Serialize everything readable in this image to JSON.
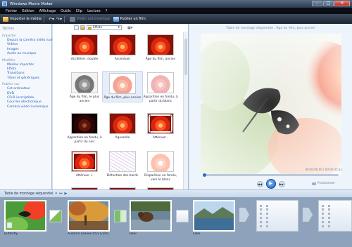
{
  "window": {
    "title": "Windows Movie Maker"
  },
  "menu": [
    "Fichier",
    "Edition",
    "Affichage",
    "Outils",
    "Clip",
    "Lecture",
    "?"
  ],
  "toolbar": {
    "import_label": "Importer le média",
    "auto_movie_label": "Vidéo automatique",
    "publish_label": "Publier un film"
  },
  "tasks": {
    "title": "Tâches",
    "sections": [
      {
        "label": "Importer",
        "links": [
          "Depuis la caméra vidéo numérique",
          "Vidéos",
          "Images",
          "Audio ou musique"
        ]
      },
      {
        "label": "Modifier",
        "links": [
          "Médias importés",
          "Effets",
          "Transitions",
          "Titres et génériques"
        ]
      },
      {
        "label": "Publier sur",
        "links": [
          "Cet ordinateur",
          "DVD",
          "CD-R inscriptible",
          "Courrier électronique",
          "Caméra vidéo numérique"
        ]
      }
    ]
  },
  "effects": {
    "dropdown_value": "Effets",
    "items": [
      {
        "label": "Accélérer, double",
        "style": "flower"
      },
      {
        "label": "Accentuer",
        "style": "flower"
      },
      {
        "label": "Âge du film, ancien",
        "style": "flower"
      },
      {
        "label": "Âge du film, le plus ancien",
        "style": "bw"
      },
      {
        "label": "Âge du film, plus ancien",
        "style": "faded",
        "selected": true
      },
      {
        "label": "Apparition en fondu, à partir du blanc",
        "style": "pinkfade"
      },
      {
        "label": "Apparition en fondu, à partir du noir",
        "style": "dark"
      },
      {
        "label": "Aquarelle",
        "style": "flower"
      },
      {
        "label": "Atténuer -",
        "style": "bordered"
      },
      {
        "label": "Atténuer +",
        "style": "bordered"
      },
      {
        "label": "Détection des bords",
        "style": "edges"
      },
      {
        "label": "Disparition en fondu, vers le blanc",
        "style": "bleach"
      }
    ]
  },
  "monitor": {
    "title": "Table de montage séquentiel : Âge du film, plus ancien",
    "time": "00:00:00,00 / 00:00:35,61",
    "split_label": "Fractionner"
  },
  "storyboard": {
    "bar_label": "Table de montage séquentiel",
    "clips": [
      {
        "caption": "Butterfly"
      },
      {
        "caption": "Autumn Leaves 05/11/200..."
      },
      {
        "caption": "Bear"
      },
      {
        "caption": "Lake"
      }
    ]
  }
}
